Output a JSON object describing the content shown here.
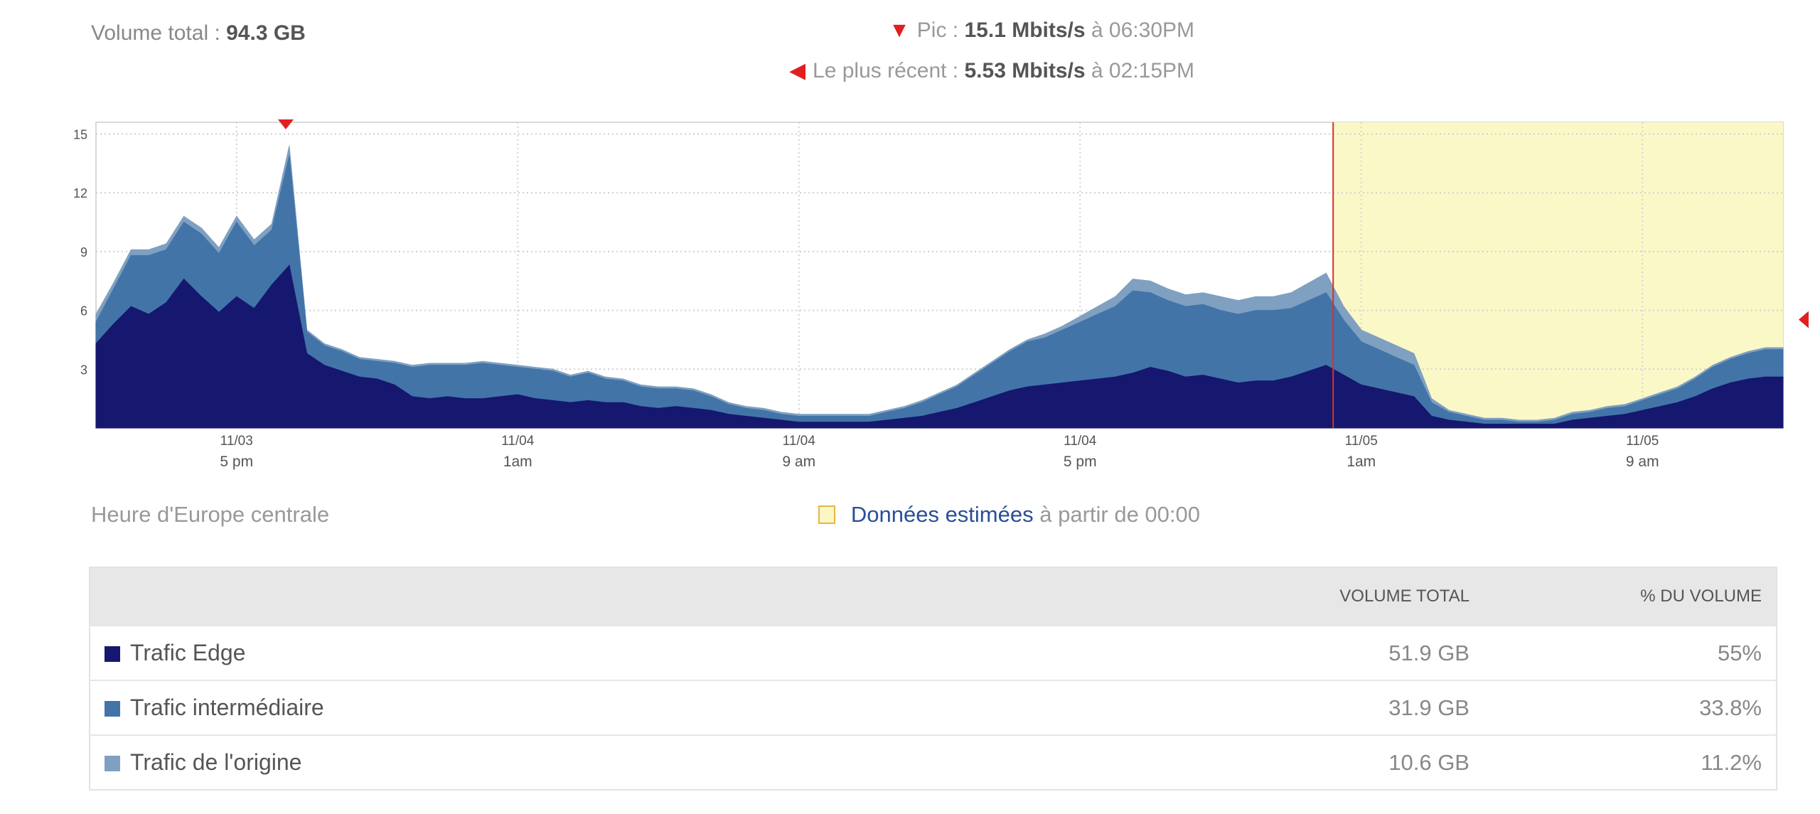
{
  "header": {
    "total_label": "Volume total :",
    "total_value": "94.3 GB",
    "peak_label": "Pic :",
    "peak_value": "15.1 Mbits/s",
    "peak_time": "à 06:30PM",
    "recent_label": "Le plus récent :",
    "recent_value": "5.53 Mbits/s",
    "recent_time": "à 02:15PM"
  },
  "legend": {
    "timezone": "Heure d'Europe centrale",
    "estimated_bold": "Données estimées",
    "estimated_rest": "à partir de 00:00"
  },
  "table": {
    "col_volume": "VOLUME TOTAL",
    "col_percent": "% DU VOLUME",
    "rows": [
      {
        "name": "Trafic Edge",
        "volume": "51.9 GB",
        "percent": "55%",
        "color": "#15186e"
      },
      {
        "name": "Trafic intermédiaire",
        "volume": "31.9 GB",
        "percent": "33.8%",
        "color": "#4274a8"
      },
      {
        "name": "Trafic de l'origine",
        "volume": "10.6 GB",
        "percent": "11.2%",
        "color": "#7fa0c0"
      }
    ]
  },
  "chart_data": {
    "type": "area",
    "stacked": true,
    "ylim": [
      0,
      15.6
    ],
    "yticks": [
      3,
      6,
      9,
      12,
      15
    ],
    "x_start": "11/03 1:00 pm",
    "x_end": "11/05 3:00 pm",
    "x_ticks": [
      {
        "date": "11/03",
        "time": "5 pm",
        "hour": 4
      },
      {
        "date": "11/04",
        "time": "1am",
        "hour": 12
      },
      {
        "date": "11/04",
        "time": "9 am",
        "hour": 20
      },
      {
        "date": "11/04",
        "time": "5 pm",
        "hour": 28
      },
      {
        "date": "11/05",
        "time": "1am",
        "hour": 36
      },
      {
        "date": "11/05",
        "time": "9 am",
        "hour": 44
      }
    ],
    "estimated_from_hour": 35.2,
    "peak_hour": 5.4,
    "recent_value": 5.53,
    "grid": true,
    "x_hours": [
      0,
      0.5,
      1,
      1.5,
      2,
      2.5,
      3,
      3.5,
      4,
      4.5,
      5,
      5.5,
      6,
      6.5,
      7,
      7.5,
      8,
      8.5,
      9,
      9.5,
      10,
      10.5,
      11,
      11.5,
      12,
      12.5,
      13,
      13.5,
      14,
      14.5,
      15,
      15.5,
      16,
      16.5,
      17,
      17.5,
      18,
      18.5,
      19,
      19.5,
      20,
      20.5,
      21,
      21.5,
      22,
      22.5,
      23,
      23.5,
      24,
      24.5,
      25,
      25.5,
      26,
      26.5,
      27,
      27.5,
      28,
      28.5,
      29,
      29.5,
      30,
      30.5,
      31,
      31.5,
      32,
      32.5,
      33,
      33.5,
      34,
      34.5,
      35,
      35.5,
      36,
      36.5,
      37,
      37.5,
      38,
      38.5,
      39,
      39.5,
      40,
      40.5,
      41,
      41.5,
      42,
      42.5,
      43,
      43.5,
      44,
      44.5,
      45,
      45.5,
      46,
      46.5,
      47,
      47.5,
      48
    ],
    "series": [
      {
        "name": "Trafic Edge",
        "color": "#15186e",
        "values": [
          4.3,
          5.3,
          6.2,
          5.8,
          6.4,
          7.6,
          6.7,
          5.9,
          6.7,
          6.1,
          7.3,
          8.3,
          3.8,
          3.2,
          2.9,
          2.6,
          2.5,
          2.2,
          1.6,
          1.5,
          1.6,
          1.5,
          1.5,
          1.6,
          1.7,
          1.5,
          1.4,
          1.3,
          1.4,
          1.3,
          1.3,
          1.1,
          1.0,
          1.1,
          1.0,
          0.9,
          0.7,
          0.6,
          0.5,
          0.4,
          0.3,
          0.3,
          0.3,
          0.3,
          0.3,
          0.4,
          0.5,
          0.6,
          0.8,
          1.0,
          1.3,
          1.6,
          1.9,
          2.1,
          2.2,
          2.3,
          2.4,
          2.5,
          2.6,
          2.8,
          3.1,
          2.9,
          2.6,
          2.7,
          2.5,
          2.3,
          2.4,
          2.4,
          2.6,
          2.9,
          3.2,
          2.7,
          2.2,
          2.0,
          1.8,
          1.6,
          0.6,
          0.4,
          0.3,
          0.2,
          0.2,
          0.2,
          0.2,
          0.2,
          0.4,
          0.5,
          0.6,
          0.7,
          0.9,
          1.1,
          1.3,
          1.6,
          2.0,
          2.3,
          2.5,
          2.6,
          2.6,
          2.6
        ]
      },
      {
        "name": "Trafic intermédiaire",
        "color": "#4274a8",
        "values": [
          1.1,
          1.8,
          2.6,
          3.0,
          2.7,
          2.9,
          3.2,
          3.0,
          3.8,
          3.2,
          2.8,
          5.6,
          1.1,
          1.0,
          1.0,
          0.9,
          0.9,
          1.1,
          1.5,
          1.7,
          1.6,
          1.7,
          1.8,
          1.6,
          1.4,
          1.5,
          1.5,
          1.3,
          1.4,
          1.2,
          1.1,
          1.0,
          1.0,
          0.9,
          0.9,
          0.7,
          0.5,
          0.4,
          0.4,
          0.3,
          0.3,
          0.3,
          0.3,
          0.3,
          0.3,
          0.4,
          0.5,
          0.7,
          0.9,
          1.1,
          1.4,
          1.7,
          2.0,
          2.3,
          2.4,
          2.7,
          3.0,
          3.3,
          3.6,
          4.2,
          3.8,
          3.6,
          3.6,
          3.6,
          3.5,
          3.5,
          3.6,
          3.6,
          3.5,
          3.6,
          3.7,
          2.8,
          2.2,
          2.0,
          1.8,
          1.6,
          0.7,
          0.4,
          0.3,
          0.2,
          0.2,
          0.1,
          0.1,
          0.2,
          0.3,
          0.3,
          0.4,
          0.4,
          0.5,
          0.6,
          0.7,
          0.9,
          1.1,
          1.2,
          1.3,
          1.4,
          1.4,
          1.4
        ]
      },
      {
        "name": "Trafic de l'origine",
        "color": "#7fa0c0",
        "values": [
          0.4,
          0.3,
          0.3,
          0.3,
          0.3,
          0.3,
          0.3,
          0.3,
          0.3,
          0.3,
          0.3,
          0.5,
          0.1,
          0.1,
          0.1,
          0.1,
          0.1,
          0.1,
          0.1,
          0.1,
          0.1,
          0.1,
          0.1,
          0.1,
          0.1,
          0.1,
          0.1,
          0.1,
          0.1,
          0.1,
          0.1,
          0.1,
          0.1,
          0.1,
          0.1,
          0.1,
          0.1,
          0.1,
          0.1,
          0.1,
          0.1,
          0.1,
          0.1,
          0.1,
          0.1,
          0.1,
          0.1,
          0.1,
          0.1,
          0.1,
          0.1,
          0.1,
          0.1,
          0.1,
          0.2,
          0.2,
          0.3,
          0.4,
          0.5,
          0.6,
          0.6,
          0.6,
          0.6,
          0.6,
          0.7,
          0.7,
          0.7,
          0.7,
          0.8,
          0.9,
          1.0,
          0.7,
          0.6,
          0.6,
          0.6,
          0.6,
          0.2,
          0.1,
          0.1,
          0.1,
          0.1,
          0.1,
          0.1,
          0.1,
          0.1,
          0.1,
          0.1,
          0.1,
          0.1,
          0.1,
          0.1,
          0.1,
          0.1,
          0.1,
          0.1,
          0.1,
          0.1,
          0.1
        ]
      }
    ]
  }
}
